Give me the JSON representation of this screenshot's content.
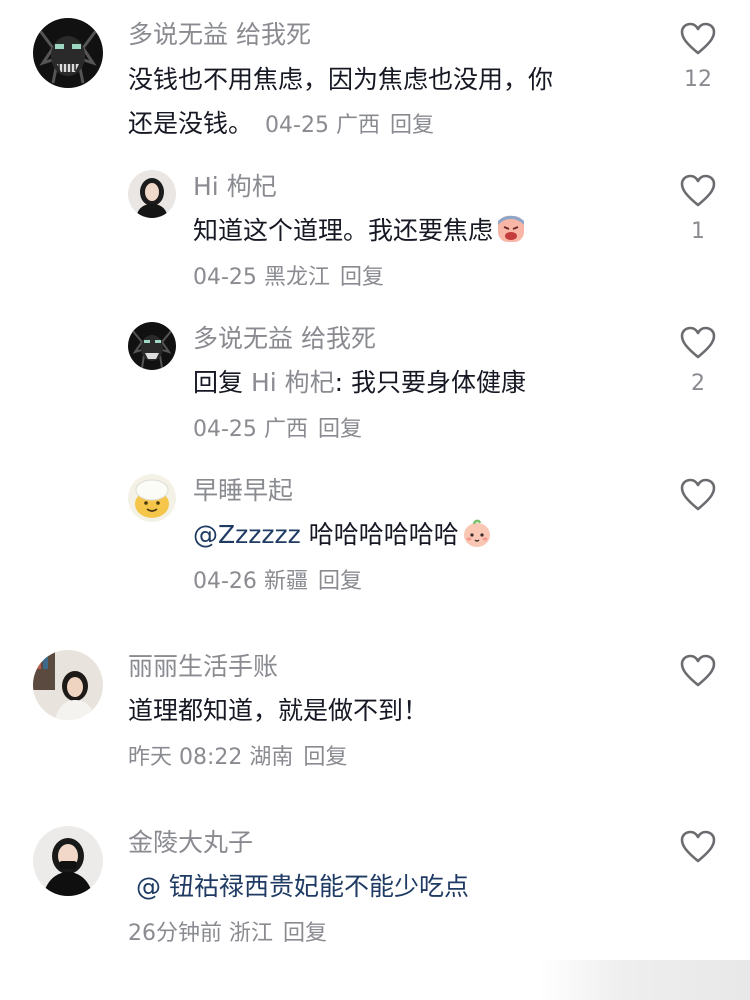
{
  "comments": [
    {
      "username": "多说无益 给我死",
      "text_line1": "没钱也不用焦虑，因为焦虑也没用，你",
      "text_line2": "还是没钱。",
      "date": "04-25",
      "location": "广西",
      "reply_label": "回复",
      "likes": "12",
      "avatar": "dark-monster-avatar"
    },
    {
      "username": "Hi 枸杞",
      "text": "知道这个道理。我还要焦虑",
      "emoji": "angry-face-emoji",
      "date": "04-25",
      "location": "黑龙江",
      "reply_label": "回复",
      "likes": "1",
      "avatar": "girl-avatar"
    },
    {
      "username": "多说无益 给我死",
      "reply_prefix": "回复",
      "reply_target": "Hi 枸杞",
      "text": ": 我只要身体健康",
      "date": "04-25",
      "location": "广西",
      "reply_label": "回复",
      "likes": "2",
      "avatar": "dark-monster-avatar"
    },
    {
      "username": "早睡早起",
      "mention": "@Zzzzzz",
      "text": " 哈哈哈哈哈哈",
      "emoji": "baby-face-emoji",
      "date": "04-26",
      "location": "新疆",
      "reply_label": "回复",
      "likes": "",
      "avatar": "cartoon-avatar"
    },
    {
      "username": "丽丽生活手账",
      "text": "道理都知道，就是做不到！",
      "date": "昨天 08:22",
      "location": "湖南",
      "reply_label": "回复",
      "likes": "",
      "avatar": "woman-avatar"
    },
    {
      "username": "金陵大丸子",
      "mention": "@ 钮祜禄西贵妃能不能少吃点",
      "date": "26分钟前",
      "location": "浙江",
      "reply_label": "回复",
      "likes": "",
      "avatar": "woman-black-avatar"
    }
  ],
  "colors": {
    "name": "#8a8b91",
    "text": "#161823",
    "mention": "#1f3b63"
  }
}
